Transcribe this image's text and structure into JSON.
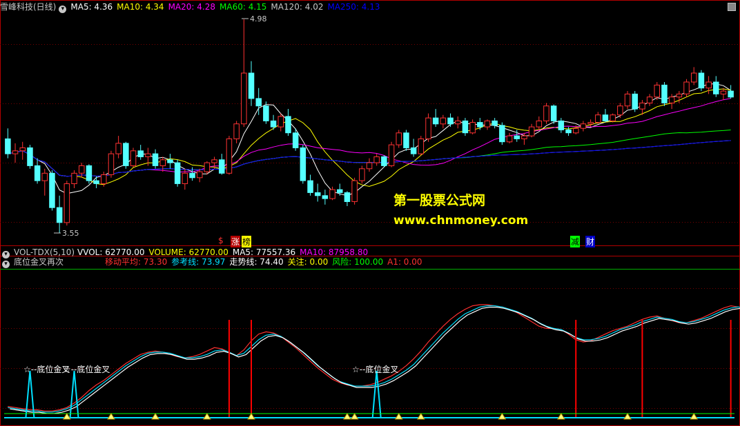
{
  "main_panel": {
    "stock_name": "雪峰科技(日线)",
    "ma_items": [
      {
        "label": "MA5: 4.36",
        "color": "#ffffff"
      },
      {
        "label": "MA10: 4.34",
        "color": "#ffff00"
      },
      {
        "label": "MA20: 4.28",
        "color": "#ff00ff"
      },
      {
        "label": "MA60: 4.15",
        "color": "#00ff00"
      },
      {
        "label": "MA120: 4.02",
        "color": "#c8c8c8"
      },
      {
        "label": "MA250: 4.13",
        "color": "#0000ff"
      }
    ],
    "high_label": "4.98",
    "low_label": "3.55",
    "tag_zhang": "涨",
    "tag_bang": "榜",
    "tag_jian": "减",
    "tag_cai": "财",
    "dollar_mark": "$"
  },
  "watermark": {
    "line1": "第一股票公式网",
    "line2": "www.chnmoney.com"
  },
  "vol_panel": {
    "name": "VOL-TDX(5,10)",
    "items": [
      {
        "label": "VVOL: 62770.00",
        "color": "#ffffff"
      },
      {
        "label": "VOLUME: 62770.00",
        "color": "#ffff00"
      },
      {
        "label": "MA5: 77557.36",
        "color": "#ffffff"
      },
      {
        "label": "MA10: 87958.80",
        "color": "#ff00ff"
      }
    ]
  },
  "indicator_panel": {
    "name": "底位金叉再次",
    "items": [
      {
        "label": "移动平均: 73.30",
        "color": "#ff3030"
      },
      {
        "label": "参考线: 73.97",
        "color": "#00e0ff"
      },
      {
        "label": "走势线: 74.40",
        "color": "#ffffff"
      },
      {
        "label": "关注: 0.00",
        "color": "#ffff00"
      },
      {
        "label": "风险: 100.00",
        "color": "#00ff00"
      },
      {
        "label": "A1: 0.00",
        "color": "#ff3030"
      }
    ],
    "signal_labels": [
      "☆--底位金叉",
      "☆--底位金叉",
      "☆--底位金叉"
    ]
  },
  "colors": {
    "up": "#ff3232",
    "down": "#54ffff",
    "border": "#b40000",
    "grid": "#7a0000"
  },
  "chart_data": {
    "type": "candlestick",
    "period": "daily",
    "price_ylim": [
      3.55,
      4.98
    ],
    "candles_ohlc": [
      [
        4.18,
        4.25,
        4.05,
        4.08
      ],
      [
        4.08,
        4.15,
        4.02,
        4.1
      ],
      [
        4.1,
        4.16,
        4.04,
        4.12
      ],
      [
        4.12,
        4.14,
        3.98,
        4.0
      ],
      [
        4.0,
        4.05,
        3.88,
        3.9
      ],
      [
        3.9,
        3.98,
        3.8,
        3.95
      ],
      [
        3.95,
        3.97,
        3.7,
        3.72
      ],
      [
        3.72,
        3.8,
        3.55,
        3.62
      ],
      [
        3.62,
        3.9,
        3.6,
        3.88
      ],
      [
        3.88,
        3.97,
        3.85,
        3.95
      ],
      [
        3.95,
        4.02,
        3.92,
        4.0
      ],
      [
        4.0,
        4.01,
        3.88,
        3.9
      ],
      [
        3.9,
        3.93,
        3.85,
        3.88
      ],
      [
        3.88,
        3.96,
        3.86,
        3.94
      ],
      [
        3.94,
        4.1,
        3.92,
        4.08
      ],
      [
        4.08,
        4.2,
        4.05,
        4.15
      ],
      [
        4.15,
        4.16,
        3.98,
        4.0
      ],
      [
        4.0,
        4.12,
        3.99,
        4.1
      ],
      [
        4.1,
        4.14,
        4.04,
        4.06
      ],
      [
        4.06,
        4.12,
        4.0,
        4.08
      ],
      [
        4.08,
        4.11,
        3.98,
        4.0
      ],
      [
        4.0,
        4.06,
        3.96,
        4.04
      ],
      [
        4.04,
        4.08,
        3.98,
        4.02
      ],
      [
        4.02,
        4.04,
        3.86,
        3.88
      ],
      [
        3.88,
        3.98,
        3.84,
        3.95
      ],
      [
        3.95,
        3.99,
        3.9,
        3.92
      ],
      [
        3.92,
        3.98,
        3.89,
        3.96
      ],
      [
        3.96,
        4.03,
        3.94,
        4.02
      ],
      [
        4.02,
        4.06,
        3.98,
        4.04
      ],
      [
        4.04,
        4.08,
        3.94,
        3.95
      ],
      [
        3.95,
        4.2,
        3.94,
        4.18
      ],
      [
        4.18,
        4.3,
        4.15,
        4.28
      ],
      [
        4.28,
        4.98,
        4.26,
        4.62
      ],
      [
        4.62,
        4.7,
        4.4,
        4.45
      ],
      [
        4.45,
        4.52,
        4.34,
        4.4
      ],
      [
        4.4,
        4.43,
        4.28,
        4.3
      ],
      [
        4.3,
        4.34,
        4.24,
        4.26
      ],
      [
        4.26,
        4.35,
        4.23,
        4.33
      ],
      [
        4.33,
        4.38,
        4.2,
        4.22
      ],
      [
        4.22,
        4.25,
        4.1,
        4.12
      ],
      [
        4.12,
        4.14,
        3.88,
        3.9
      ],
      [
        3.9,
        3.94,
        3.8,
        3.82
      ],
      [
        3.82,
        3.88,
        3.76,
        3.8
      ],
      [
        3.8,
        3.84,
        3.74,
        3.78
      ],
      [
        3.78,
        3.86,
        3.77,
        3.84
      ],
      [
        3.84,
        3.88,
        3.8,
        3.82
      ],
      [
        3.82,
        3.83,
        3.73,
        3.76
      ],
      [
        3.76,
        3.92,
        3.74,
        3.9
      ],
      [
        3.9,
        4.0,
        3.88,
        3.98
      ],
      [
        3.98,
        4.05,
        3.96,
        4.02
      ],
      [
        4.02,
        4.08,
        4.0,
        4.06
      ],
      [
        4.06,
        4.07,
        3.99,
        4.0
      ],
      [
        4.0,
        4.16,
        3.99,
        4.14
      ],
      [
        4.14,
        4.24,
        4.12,
        4.22
      ],
      [
        4.22,
        4.24,
        4.1,
        4.12
      ],
      [
        4.12,
        4.18,
        4.06,
        4.08
      ],
      [
        4.08,
        4.2,
        4.07,
        4.18
      ],
      [
        4.18,
        4.35,
        4.16,
        4.32
      ],
      [
        4.32,
        4.38,
        4.26,
        4.28
      ],
      [
        4.28,
        4.34,
        4.25,
        4.32
      ],
      [
        4.32,
        4.35,
        4.26,
        4.28
      ],
      [
        4.28,
        4.33,
        4.25,
        4.3
      ],
      [
        4.3,
        4.32,
        4.2,
        4.22
      ],
      [
        4.22,
        4.31,
        4.21,
        4.29
      ],
      [
        4.29,
        4.32,
        4.24,
        4.26
      ],
      [
        4.26,
        4.31,
        4.24,
        4.3
      ],
      [
        4.3,
        4.32,
        4.25,
        4.27
      ],
      [
        4.27,
        4.29,
        4.14,
        4.16
      ],
      [
        4.16,
        4.22,
        4.15,
        4.2
      ],
      [
        4.2,
        4.24,
        4.16,
        4.18
      ],
      [
        4.18,
        4.22,
        4.14,
        4.2
      ],
      [
        4.2,
        4.28,
        4.19,
        4.26
      ],
      [
        4.26,
        4.33,
        4.24,
        4.3
      ],
      [
        4.3,
        4.42,
        4.28,
        4.4
      ],
      [
        4.4,
        4.41,
        4.28,
        4.3
      ],
      [
        4.3,
        4.32,
        4.22,
        4.24
      ],
      [
        4.24,
        4.26,
        4.2,
        4.22
      ],
      [
        4.22,
        4.27,
        4.21,
        4.25
      ],
      [
        4.25,
        4.3,
        4.23,
        4.28
      ],
      [
        4.28,
        4.31,
        4.26,
        4.29
      ],
      [
        4.29,
        4.36,
        4.28,
        4.34
      ],
      [
        4.34,
        4.38,
        4.29,
        4.3
      ],
      [
        4.3,
        4.35,
        4.29,
        4.34
      ],
      [
        4.34,
        4.42,
        4.32,
        4.4
      ],
      [
        4.4,
        4.5,
        4.38,
        4.48
      ],
      [
        4.48,
        4.5,
        4.36,
        4.38
      ],
      [
        4.38,
        4.44,
        4.34,
        4.42
      ],
      [
        4.42,
        4.48,
        4.4,
        4.46
      ],
      [
        4.46,
        4.56,
        4.44,
        4.54
      ],
      [
        4.54,
        4.56,
        4.4,
        4.42
      ],
      [
        4.42,
        4.48,
        4.38,
        4.46
      ],
      [
        4.46,
        4.5,
        4.42,
        4.48
      ],
      [
        4.48,
        4.58,
        4.46,
        4.56
      ],
      [
        4.56,
        4.66,
        4.54,
        4.62
      ],
      [
        4.62,
        4.64,
        4.5,
        4.52
      ],
      [
        4.52,
        4.6,
        4.48,
        4.56
      ],
      [
        4.56,
        4.6,
        4.46,
        4.48
      ],
      [
        4.48,
        4.52,
        4.44,
        4.5
      ],
      [
        4.5,
        4.54,
        4.45,
        4.46
      ]
    ],
    "indicator_ylim": [
      0,
      100
    ],
    "indicator_lines": [
      {
        "name": "移动平均",
        "color": "#ff3030",
        "values": [
          10,
          9,
          8,
          7,
          7,
          6,
          6,
          7,
          9,
          13,
          18,
          24,
          29,
          33,
          38,
          43,
          48,
          52,
          56,
          58,
          59,
          58,
          56,
          54,
          53,
          54,
          56,
          59,
          62,
          61,
          58,
          55,
          60,
          68,
          74,
          76,
          75,
          72,
          67,
          62,
          56,
          50,
          44,
          39,
          34,
          31,
          29,
          28,
          28,
          29,
          31,
          34,
          37,
          41,
          46,
          52,
          59,
          67,
          74,
          81,
          87,
          92,
          96,
          99,
          100,
          100,
          99,
          98,
          96,
          93,
          89,
          85,
          81,
          79,
          79,
          78,
          74,
          69,
          67,
          68,
          71,
          74,
          77,
          79,
          81,
          84,
          87,
          89,
          90,
          88,
          86,
          84,
          84,
          86,
          88,
          91,
          94,
          97,
          99,
          98,
          97
        ]
      },
      {
        "name": "参考线",
        "color": "#00e0ff",
        "values": [
          9,
          8,
          7,
          6,
          6,
          5,
          5,
          6,
          8,
          11,
          16,
          21,
          26,
          31,
          36,
          41,
          46,
          50,
          54,
          57,
          58,
          58,
          57,
          55,
          53,
          53,
          54,
          56,
          59,
          60,
          58,
          55,
          57,
          63,
          69,
          73,
          74,
          72,
          68,
          63,
          58,
          52,
          46,
          41,
          36,
          32,
          30,
          28,
          28,
          28,
          29,
          31,
          34,
          38,
          42,
          47,
          54,
          61,
          68,
          75,
          81,
          87,
          92,
          95,
          98,
          99,
          99,
          98,
          96,
          94,
          91,
          88,
          84,
          81,
          79,
          78,
          75,
          71,
          69,
          69,
          70,
          72,
          75,
          78,
          80,
          82,
          85,
          87,
          89,
          88,
          87,
          85,
          84,
          85,
          87,
          89,
          92,
          95,
          97,
          98,
          97
        ]
      },
      {
        "name": "走势线",
        "color": "#ffffff",
        "values": [
          9,
          8,
          7,
          6,
          6,
          5,
          5,
          6,
          8,
          11,
          16,
          21,
          26,
          31,
          36,
          41,
          46,
          50,
          54,
          57,
          58,
          58,
          57,
          55,
          53,
          53,
          54,
          56,
          59,
          60,
          58,
          55,
          57,
          63,
          69,
          73,
          74,
          72,
          68,
          63,
          58,
          52,
          46,
          41,
          36,
          32,
          30,
          28,
          28,
          28,
          29,
          31,
          34,
          38,
          42,
          47,
          54,
          61,
          68,
          75,
          81,
          87,
          92,
          95,
          98,
          99,
          99,
          98,
          96,
          94,
          91,
          88,
          84,
          81,
          79,
          78,
          75,
          71,
          69,
          69,
          70,
          72,
          75,
          78,
          80,
          82,
          85,
          87,
          89,
          88,
          87,
          85,
          84,
          85,
          87,
          89,
          92,
          95,
          97,
          98,
          97
        ]
      }
    ],
    "golden_cross_spike_indices": [
      3,
      9,
      50
    ],
    "risk_spike_indices": [
      30,
      33,
      77,
      86,
      98
    ]
  }
}
